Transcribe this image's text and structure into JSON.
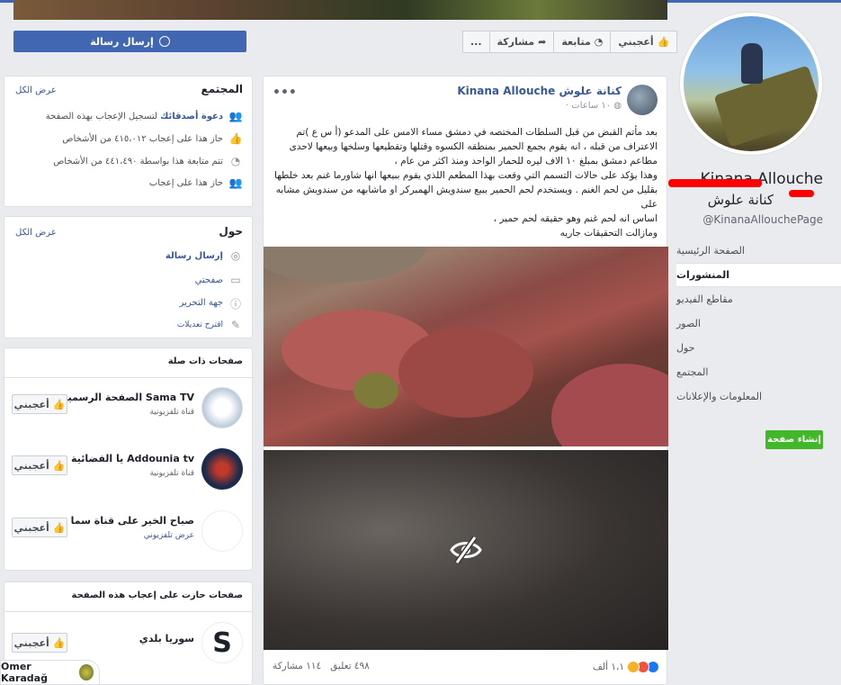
{
  "header": {
    "send_message": "إرسال رسالة",
    "like": "أعجبني",
    "follow": "متابعة",
    "share": "مشاركة",
    "more": "..."
  },
  "profile": {
    "name": "Kinana Allouche",
    "name_ar": "كنانة علوش",
    "handle": "@KinanaAllouchePage",
    "nav": [
      {
        "label": "الصفحة الرئيسية",
        "active": false
      },
      {
        "label": "المنشورات",
        "active": true
      },
      {
        "label": "مقاطع الفيديو",
        "active": false
      },
      {
        "label": "الصور",
        "active": false
      },
      {
        "label": "حول",
        "active": false
      },
      {
        "label": "المجتمع",
        "active": false
      },
      {
        "label": "المعلومات والإعلانات",
        "active": false
      }
    ],
    "create_page": "إنشاء صفحة"
  },
  "community": {
    "title": "المجتمع",
    "see_all": "عرض الكل",
    "invite_bold": "دعوة أصدقائك",
    "invite_rest": "لتسجيل الإعجاب بهذه الصفحة",
    "likes": "حاز هذا على إعجاب ٤١٥،٠١٢ من الأشخاص",
    "follows": "تتم متابعة هذا بواسطة ٤٤١،٤٩٠ من الأشخاص",
    "liked_by": "حاز هذا على إعجاب"
  },
  "about": {
    "title": "حول",
    "see_all": "عرض الكل",
    "send_message": "إرسال رسالة",
    "website": "صفحتي",
    "category": "جهة التحرير",
    "suggest": "اقترح تعديلات"
  },
  "related": {
    "title": "صفحات ذات صلة",
    "like": "أعجبني",
    "items": [
      {
        "name": "Sama TV الصفحة الرسمية..",
        "cat": "قناة تلفزيونية"
      },
      {
        "name": "Addounia tv يا الفضائية ..",
        "cat": "قناة تلفزيونية"
      },
      {
        "name": "صباح الخير على قناة سما",
        "cat": "عرض تلفزيوني"
      }
    ]
  },
  "liked_pages": {
    "title": "صفحات حازت على إعجاب هذه الصفحة",
    "like": "أعجبني",
    "items": [
      {
        "name": "سوريا بلدي"
      }
    ]
  },
  "post": {
    "author": "كنانة علوش Kinana Allouche",
    "time": "١٠ ساعات ·",
    "text_lines": [
      "بعد مأتم القبض من قبل السلطات المختصه في دمشق مساء الامس على المدعو (أ س ع )تم",
      "الاعتراف من قبله ، انه يقوم بجمع الحمير بمنطقه الكسوه وقتلها وتقطيعها وسلخها وبيعها لاحدى",
      "مطاعم دمشق بمبلغ ١٠ الاف ليره للحمار الواحد ومنذ اكثر من عام ،",
      "وهذا يؤكد على حالات التسمم التي وقعت بهذا المطعم اللذي يقوم ببيعها انها شاورما غنم بعد خلطها",
      "بقليل من لحم الغنم . ويستخدم لحم الحمير ببيع سندويش الهمبركر او ماشابهه من سندويش مشابه على",
      "اساس انه لحم غنم وهو حقيقه لحم حمير ،",
      "ومازالت التحقيقات جاريه"
    ],
    "reactions_count": "١،١ ألف",
    "comments": "٤٩٨ تعليق",
    "shares": "١١٤ مشاركة"
  },
  "chat": {
    "name": "Omer Karadağ"
  }
}
